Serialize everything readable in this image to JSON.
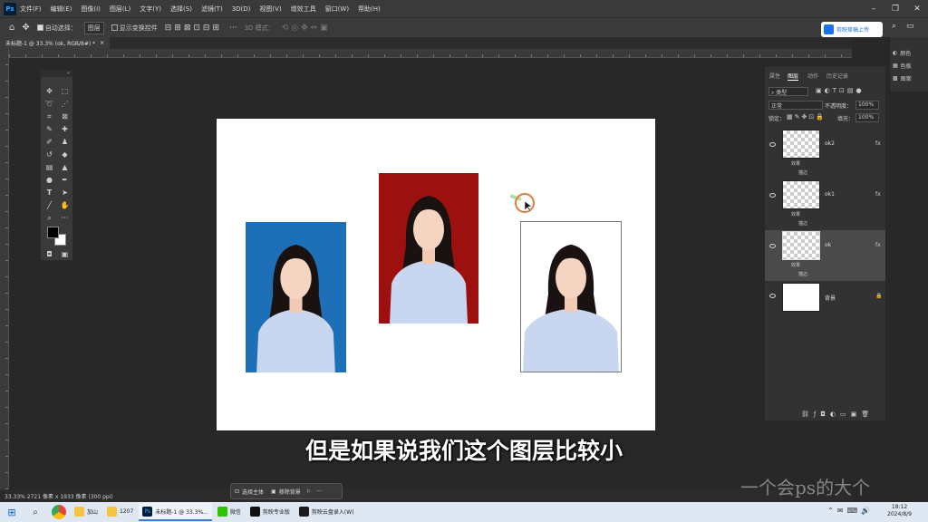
{
  "app": {
    "logo": "Ps"
  },
  "menubar": {
    "items": [
      "文件(F)",
      "编辑(E)",
      "图像(I)",
      "图层(L)",
      "文字(Y)",
      "选择(S)",
      "滤镜(T)",
      "3D(D)",
      "视图(V)",
      "增效工具",
      "窗口(W)",
      "帮助(H)"
    ]
  },
  "options": {
    "auto_select_label": "自动选择：",
    "auto_select_value": "图层",
    "transform_label": "显示变换控件",
    "mode_label": "3D 模式："
  },
  "upload_button": {
    "label": "剪映草稿上传"
  },
  "document_tab": {
    "title": "未标题-1 @ 33.3% (ok, RGB/8#) *"
  },
  "right_strip": {
    "items": [
      "颜色",
      "色板",
      "图案"
    ]
  },
  "layers_panel": {
    "tabs": [
      "属性",
      "图层",
      "动作",
      "历史记录"
    ],
    "filter_label": "类型",
    "blend_mode": "正常",
    "opacity_label": "不透明度：",
    "opacity_value": "100%",
    "lock_label": "锁定：",
    "fill_label": "填充：",
    "fill_value": "100%",
    "fx_label": "fx",
    "layers": [
      {
        "name": "ok2",
        "effects": "效果",
        "effect_item": "描边"
      },
      {
        "name": "ok1",
        "effects": "效果",
        "effect_item": "描边"
      },
      {
        "name": "ok",
        "effects": "效果",
        "effect_item": "描边"
      },
      {
        "name": "背景"
      }
    ]
  },
  "context_bar": {
    "select_subject": "选择主体",
    "remove_bg": "移除背景"
  },
  "status": {
    "text": "33.33%   2721 像素 x 1933 像素 (300 ppi)"
  },
  "subtitle": "但是如果说我们这个图层比较小",
  "watermark": "一个会ps的大个",
  "taskbar": {
    "apps": [
      {
        "label": "加山",
        "color": "#f5c542"
      },
      {
        "label": "1207",
        "color": "#f5c542"
      },
      {
        "label": "未标题-1 @ 33.3%...",
        "color": "#001e36",
        "active": true
      },
      {
        "label": "微信",
        "color": "#2dc100"
      },
      {
        "label": "剪映专业版",
        "color": "#111111"
      },
      {
        "label": "剪映云盘录入(W)",
        "color": "#1b1b1b"
      }
    ],
    "time": "18:12",
    "date": "2024/8/9"
  },
  "colors": {
    "photo1_bg": "#1d6fb8",
    "photo2_bg": "#9c1010",
    "photo3_bg": "#ffffff",
    "shirt": "#c9d6f0",
    "hair": "#1a1210"
  }
}
